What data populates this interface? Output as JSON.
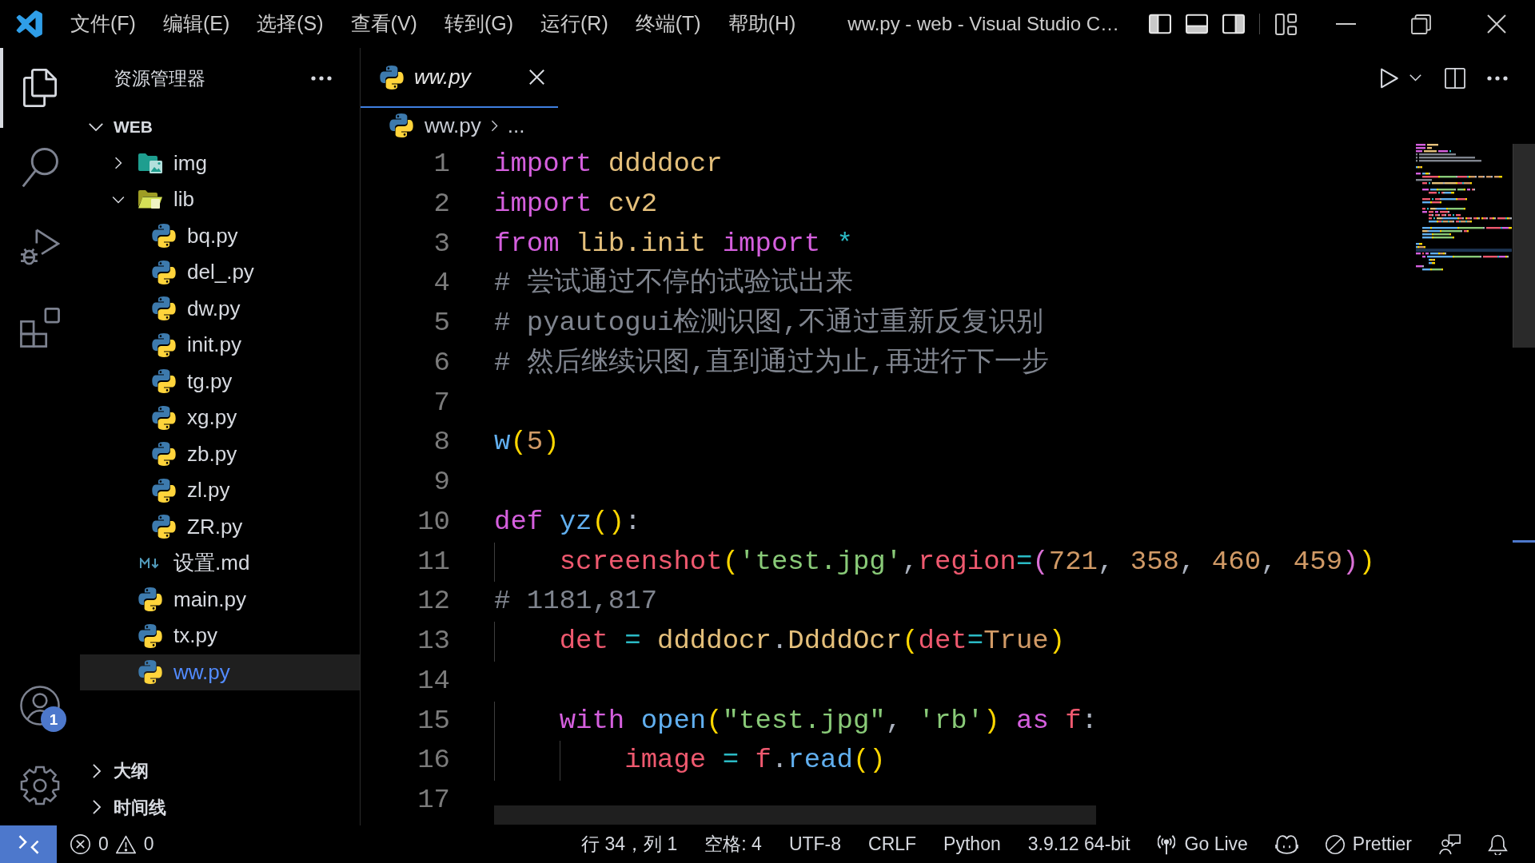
{
  "title_bar": {
    "menus": [
      "文件(F)",
      "编辑(E)",
      "选择(S)",
      "查看(V)",
      "转到(G)",
      "运行(R)",
      "终端(T)",
      "帮助(H)"
    ],
    "title": "ww.py - web - Visual Studio C…",
    "layout_toggles": [
      {
        "kind": "sidebar",
        "on": true
      },
      {
        "kind": "panel",
        "on": true
      },
      {
        "kind": "secondary",
        "on": true
      }
    ]
  },
  "activity_bar": {
    "items": [
      {
        "kind": "explorer",
        "selected": true
      },
      {
        "kind": "search",
        "selected": false
      },
      {
        "kind": "debug",
        "selected": false
      },
      {
        "kind": "extensions",
        "selected": false
      }
    ],
    "accounts_badge": "1"
  },
  "explorer": {
    "title": "资源管理器",
    "root": {
      "label": "WEB",
      "expanded": true,
      "children": [
        {
          "label": "img",
          "kind": "pictures",
          "expanded": false,
          "selected": false
        },
        {
          "label": "lib",
          "kind": "folder",
          "expanded": true,
          "selected": false,
          "children": [
            {
              "label": "bq.py",
              "kind": "python",
              "selected": false
            },
            {
              "label": "del_.py",
              "kind": "python",
              "selected": false
            },
            {
              "label": "dw.py",
              "kind": "python",
              "selected": false
            },
            {
              "label": "init.py",
              "kind": "python",
              "selected": false
            },
            {
              "label": "tg.py",
              "kind": "python",
              "selected": false
            },
            {
              "label": "xg.py",
              "kind": "python",
              "selected": false
            },
            {
              "label": "zb.py",
              "kind": "python",
              "selected": false
            },
            {
              "label": "zl.py",
              "kind": "python",
              "selected": false
            },
            {
              "label": "ZR.py",
              "kind": "python",
              "selected": false
            }
          ]
        },
        {
          "label": "设置.md",
          "kind": "markdown",
          "selected": false
        },
        {
          "label": "main.py",
          "kind": "python",
          "selected": false
        },
        {
          "label": "tx.py",
          "kind": "python",
          "selected": false
        },
        {
          "label": "ww.py",
          "kind": "python",
          "selected": true
        }
      ]
    },
    "sections": [
      {
        "label": "大纲",
        "expanded": false
      },
      {
        "label": "时间线",
        "expanded": false
      }
    ]
  },
  "editor": {
    "tabs": [
      {
        "label": "ww.py",
        "selected": true,
        "preview": true
      }
    ],
    "breadcrumb": [
      {
        "label": "ww.py",
        "kind": "file"
      },
      {
        "label": "...",
        "kind": "symbols"
      }
    ],
    "lines": [
      {
        "number": "1",
        "tokens": [
          {
            "text": "import ",
            "kind": "keyword"
          },
          {
            "text": "ddddocr",
            "kind": "class"
          }
        ]
      },
      {
        "number": "2",
        "tokens": [
          {
            "text": "import ",
            "kind": "keyword"
          },
          {
            "text": "cv2",
            "kind": "class"
          }
        ]
      },
      {
        "number": "3",
        "tokens": [
          {
            "text": "from ",
            "kind": "keyword"
          },
          {
            "text": "lib.init ",
            "kind": "class"
          },
          {
            "text": "import ",
            "kind": "keyword"
          },
          {
            "text": "*",
            "kind": "operator"
          }
        ]
      },
      {
        "number": "4",
        "tokens": [
          {
            "text": "# 尝试通过不停的试验试出来",
            "kind": "comment"
          }
        ]
      },
      {
        "number": "5",
        "tokens": [
          {
            "text": "# pyautogui检测识图,不通过重新反复识别",
            "kind": "comment"
          }
        ]
      },
      {
        "number": "6",
        "tokens": [
          {
            "text": "# 然后继续识图,直到通过为止,再进行下一步",
            "kind": "comment"
          }
        ]
      },
      {
        "number": "7"
      },
      {
        "number": "8",
        "tokens": [
          {
            "text": "w",
            "kind": "function"
          },
          {
            "text": "(",
            "kind": "bracket1"
          },
          {
            "text": "5",
            "kind": "number"
          },
          {
            "text": ")",
            "kind": "bracket1"
          }
        ]
      },
      {
        "number": "9"
      },
      {
        "number": "10",
        "tokens": [
          {
            "text": "def ",
            "kind": "keyword"
          },
          {
            "text": "yz",
            "kind": "function"
          },
          {
            "text": "()",
            "kind": "bracket1"
          },
          {
            "text": ":",
            "kind": "plain"
          }
        ]
      },
      {
        "number": "11",
        "tokens": [
          {
            "text": "    screenshot",
            "kind": "variable"
          },
          {
            "text": "(",
            "kind": "bracket1"
          },
          {
            "text": "'test.jpg'",
            "kind": "string"
          },
          {
            "text": ",",
            "kind": "plain"
          },
          {
            "text": "region",
            "kind": "variable"
          },
          {
            "text": "=",
            "kind": "operator"
          },
          {
            "text": "(",
            "kind": "bracket2"
          },
          {
            "text": "721",
            "kind": "number"
          },
          {
            "text": ", ",
            "kind": "plain"
          },
          {
            "text": "358",
            "kind": "number"
          },
          {
            "text": ", ",
            "kind": "plain"
          },
          {
            "text": "460",
            "kind": "number"
          },
          {
            "text": ", ",
            "kind": "plain"
          },
          {
            "text": "459",
            "kind": "number"
          },
          {
            "text": ")",
            "kind": "bracket2"
          },
          {
            "text": ")",
            "kind": "bracket1"
          }
        ]
      },
      {
        "number": "12",
        "tokens": [
          {
            "text": "# 1181,817",
            "kind": "comment"
          }
        ]
      },
      {
        "number": "13",
        "tokens": [
          {
            "text": "    det ",
            "kind": "variable"
          },
          {
            "text": "= ",
            "kind": "operator"
          },
          {
            "text": "ddddocr",
            "kind": "class"
          },
          {
            "text": ".",
            "kind": "plain"
          },
          {
            "text": "DdddOcr",
            "kind": "class"
          },
          {
            "text": "(",
            "kind": "bracket1"
          },
          {
            "text": "det",
            "kind": "variable"
          },
          {
            "text": "=",
            "kind": "operator"
          },
          {
            "text": "True",
            "kind": "constant"
          },
          {
            "text": ")",
            "kind": "bracket1"
          }
        ]
      },
      {
        "number": "14"
      },
      {
        "number": "15",
        "tokens": [
          {
            "text": "    with ",
            "kind": "keyword"
          },
          {
            "text": "open",
            "kind": "function"
          },
          {
            "text": "(",
            "kind": "bracket1"
          },
          {
            "text": "\"test.jpg\"",
            "kind": "string"
          },
          {
            "text": ", ",
            "kind": "plain"
          },
          {
            "text": "'rb'",
            "kind": "string"
          },
          {
            "text": ") ",
            "kind": "bracket1"
          },
          {
            "text": "as ",
            "kind": "keyword"
          },
          {
            "text": "f",
            "kind": "variable"
          },
          {
            "text": ":",
            "kind": "plain"
          }
        ]
      },
      {
        "number": "16",
        "tokens": [
          {
            "text": "        image ",
            "kind": "variable"
          },
          {
            "text": "= ",
            "kind": "operator"
          },
          {
            "text": "f",
            "kind": "variable"
          },
          {
            "text": ".",
            "kind": "plain"
          },
          {
            "text": "read",
            "kind": "function"
          },
          {
            "text": "()",
            "kind": "bracket1"
          }
        ]
      },
      {
        "number": "17"
      }
    ]
  },
  "status_bar": {
    "problems": {
      "errors": "0",
      "warnings": "0"
    },
    "cursor": "行 34，列 1",
    "indentation": "空格: 4",
    "encoding": "UTF-8",
    "line_ending": "CRLF",
    "language": "Python",
    "interpreter": "3.9.12 64-bit",
    "live_server": "Go Live",
    "formatter": "Prettier"
  }
}
